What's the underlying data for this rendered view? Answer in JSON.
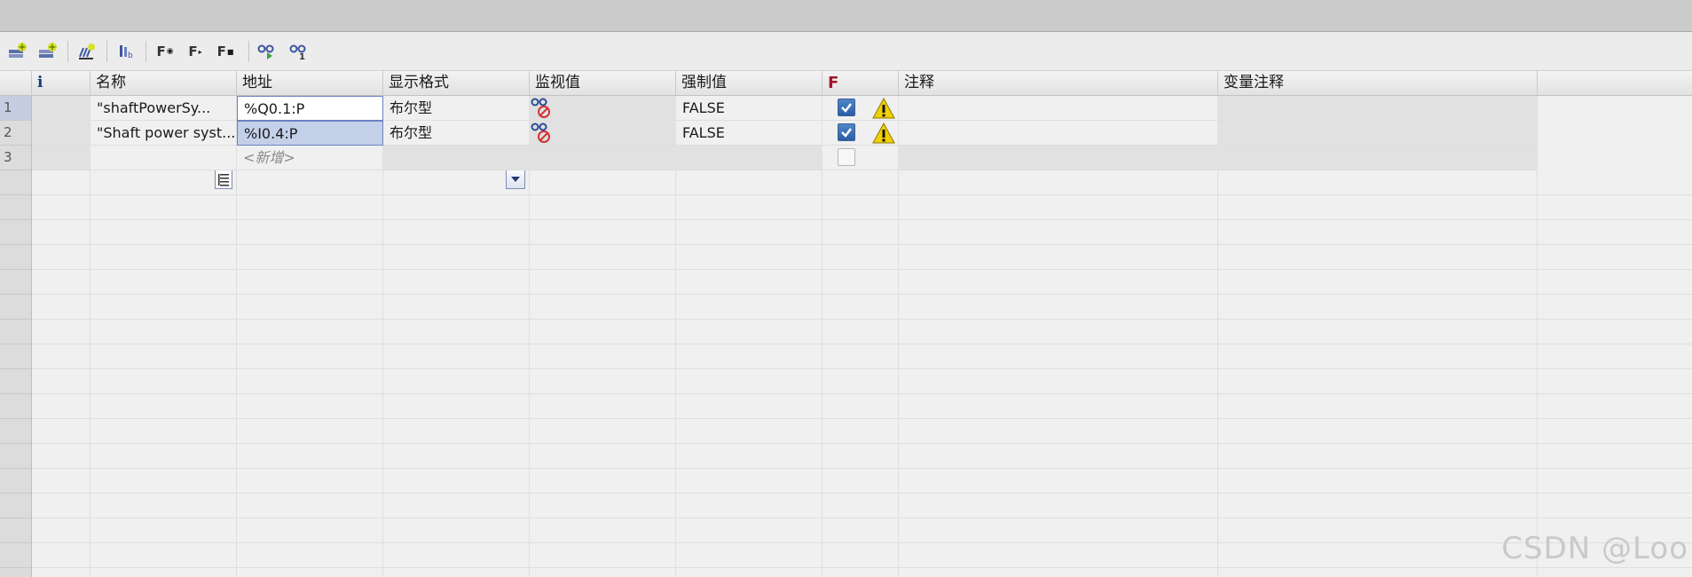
{
  "toolbar": {
    "icons": [
      "add-row-icon",
      "insert-row-icon",
      "update-icon",
      "display-format-icon",
      "force-icon",
      "force-stop-icon",
      "force-stop-all-icon",
      "monitor-icon",
      "monitor-once-icon"
    ],
    "force_labels": [
      "F",
      "F",
      "F"
    ]
  },
  "table": {
    "headers": {
      "info": "i",
      "name": "名称",
      "address": "地址",
      "display_format": "显示格式",
      "monitor_value": "监视值",
      "force_value": "强制值",
      "force_flag": "F",
      "comment": "注释",
      "tag_comment": "变量注释"
    },
    "rows": [
      {
        "num": "1",
        "name": "\"shaftPowerSy...",
        "address": "%Q0.1:P",
        "display_format": "布尔型",
        "force_value": "FALSE",
        "force_checked": true,
        "warning": true
      },
      {
        "num": "2",
        "name": "\"Shaft power syst...",
        "address": "%I0.4:P",
        "display_format": "布尔型",
        "force_value": "FALSE",
        "force_checked": true,
        "warning": true
      },
      {
        "num": "3",
        "name": "",
        "address_placeholder": "<新增>",
        "display_format": "",
        "force_value": "",
        "force_checked": false,
        "warning": false
      }
    ]
  },
  "colors": {
    "accent": "#2a5fa8",
    "selection": "#c4cfe8",
    "force_flag": "#a4142a",
    "warning": "#f0d000"
  },
  "watermark": "CSDN @Loo"
}
